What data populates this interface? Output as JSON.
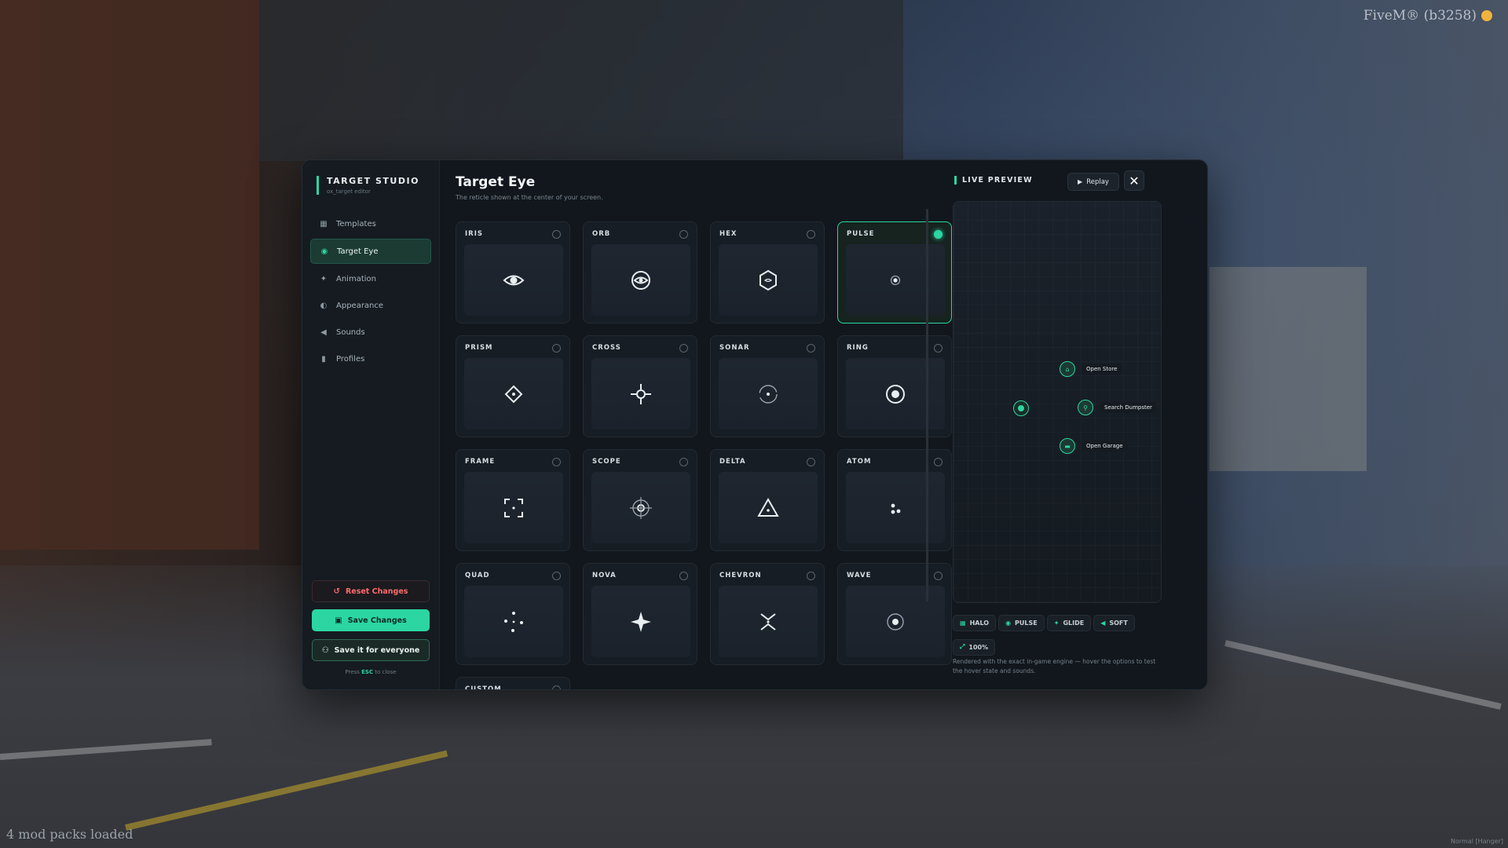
{
  "overlay": {
    "fivem_title": "FiveM® (b3258)",
    "mod_packs": "4 mod packs loaded",
    "corner_note": "Normal [Hanger]"
  },
  "sidebar": {
    "brand_title": "TARGET STUDIO",
    "brand_sub": "ox_target editor",
    "items": [
      {
        "label": "Templates",
        "icon": "grid-icon",
        "glyph": "▦"
      },
      {
        "label": "Target Eye",
        "icon": "eye-icon",
        "glyph": "◉",
        "active": true
      },
      {
        "label": "Animation",
        "icon": "magic-wand-icon",
        "glyph": "✦"
      },
      {
        "label": "Appearance",
        "icon": "palette-icon",
        "glyph": "◐"
      },
      {
        "label": "Sounds",
        "icon": "speaker-icon",
        "glyph": "◀"
      },
      {
        "label": "Profiles",
        "icon": "bookmark-icon",
        "glyph": "▮"
      }
    ],
    "reset_label": "Reset Changes",
    "save_label": "Save Changes",
    "everyone_label": "Save it for everyone",
    "esc_prefix": "Press ",
    "esc_key": "ESC",
    "esc_suffix": " to close"
  },
  "main": {
    "title": "Target Eye",
    "subtitle": "The reticle shown at the center of your screen.",
    "selected": "PULSE",
    "reticles": [
      {
        "label": "IRIS",
        "icon": "eye"
      },
      {
        "label": "ORB",
        "icon": "orb"
      },
      {
        "label": "HEX",
        "icon": "hex"
      },
      {
        "label": "PULSE",
        "icon": "pulse"
      },
      {
        "label": "PRISM",
        "icon": "prism"
      },
      {
        "label": "CROSS",
        "icon": "cross"
      },
      {
        "label": "SONAR",
        "icon": "sonar"
      },
      {
        "label": "RING",
        "icon": "ring"
      },
      {
        "label": "FRAME",
        "icon": "frame"
      },
      {
        "label": "SCOPE",
        "icon": "scope"
      },
      {
        "label": "DELTA",
        "icon": "delta"
      },
      {
        "label": "ATOM",
        "icon": "atom"
      },
      {
        "label": "QUAD",
        "icon": "quad"
      },
      {
        "label": "NOVA",
        "icon": "nova"
      },
      {
        "label": "CHEVRON",
        "icon": "chevron"
      },
      {
        "label": "WAVE",
        "icon": "wave"
      },
      {
        "label": "CUSTOM",
        "icon": "custom"
      }
    ]
  },
  "preview": {
    "title": "LIVE PREVIEW",
    "replay_label": "Replay",
    "options": [
      {
        "label": "Open Store",
        "icon": "store-icon",
        "glyph": "⌂"
      },
      {
        "label": "Search Dumpster",
        "icon": "search-icon",
        "glyph": "⚲"
      },
      {
        "label": "Open Garage",
        "icon": "car-icon",
        "glyph": "▬"
      }
    ],
    "chips": [
      {
        "label": "HALO",
        "icon": "halo-icon",
        "glyph": "▦"
      },
      {
        "label": "PULSE",
        "icon": "eye-icon",
        "glyph": "◉"
      },
      {
        "label": "GLIDE",
        "icon": "magic-wand-icon",
        "glyph": "✦"
      },
      {
        "label": "SOFT",
        "icon": "speaker-icon",
        "glyph": "◀"
      },
      {
        "label": "100%",
        "icon": "resize-icon",
        "glyph": "⤢"
      }
    ],
    "note": "Rendered with the exact in-game engine — hover the options to test the hover state and sounds."
  },
  "colors": {
    "accent": "#2bd6a2",
    "danger": "#ff6b6b",
    "panel": "#12171d"
  }
}
